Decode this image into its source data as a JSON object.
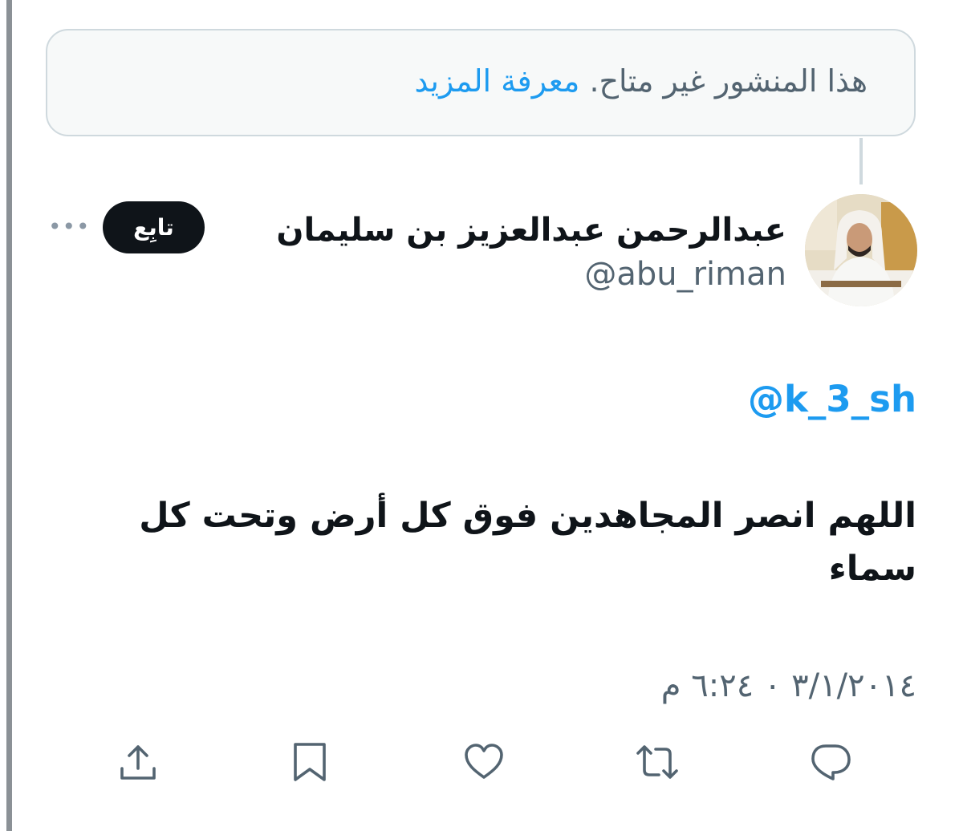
{
  "unavailable": {
    "message": "هذا المنشور غير متاح.",
    "learn_more": "معرفة المزيد"
  },
  "author": {
    "name": "عبدالرحمن عبدالعزيز بن سليمان",
    "handle": "@abu_riman"
  },
  "follow_label": "تابِع",
  "more_label": "•••",
  "tweet": {
    "mention": "@k_3_sh",
    "text": "اللهم انصر المجاهدين فوق كل أرض وتحت كل سماء",
    "timestamp": "٣/١/٢٠١٤ ٠ ٦:٢٤ م"
  },
  "actions": [
    "share-icon",
    "bookmark-icon",
    "like-icon",
    "retweet-icon",
    "reply-icon"
  ],
  "colors": {
    "accent": "#1d9bf0",
    "text": "#0f1419",
    "muted": "#536471",
    "border": "#cfd9de"
  }
}
